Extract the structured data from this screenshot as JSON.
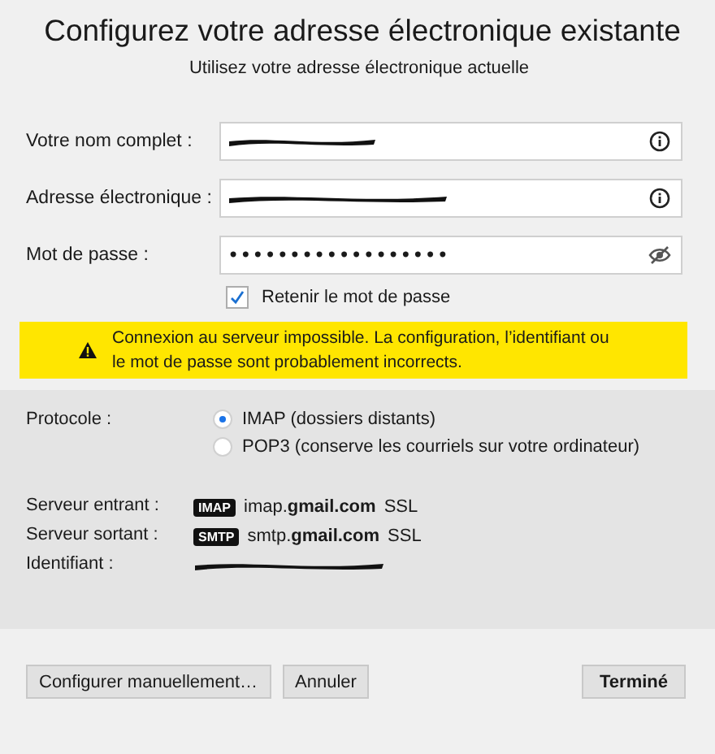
{
  "header": {
    "title": "Configurez votre adresse électronique existante",
    "subtitle": "Utilisez votre adresse électronique actuelle"
  },
  "fields": [
    {
      "kind": "text",
      "label": "Votre nom complet :",
      "redacted": true
    },
    {
      "kind": "text",
      "label": "Adresse électronique :",
      "redacted": true
    },
    {
      "kind": "password",
      "label": "Mot de passe :",
      "value": "••••••••••••••••••"
    }
  ],
  "remember": {
    "label": "Retenir le mot de passe",
    "checked": true
  },
  "warning": {
    "text": "Connexion au serveur impossible. La configuration, l’identifiant ou\nle mot de passe sont probablement incorrects."
  },
  "protocol": {
    "label": "Protocole :",
    "options": [
      {
        "label": "IMAP (dossiers distants)",
        "selected": true
      },
      {
        "label": "POP3 (conserve les courriels sur votre ordinateur)",
        "selected": false
      }
    ]
  },
  "servers": [
    {
      "label": "Serveur entrant :",
      "badge": "IMAP",
      "host": "imap.**gmail.com**",
      "security": "SSL"
    },
    {
      "label": "Serveur sortant :",
      "badge": "SMTP",
      "host": "smtp.**gmail.com**",
      "security": "SSL"
    }
  ],
  "identifier": {
    "label": "Identifiant :",
    "redacted": true
  },
  "buttons": [
    {
      "label": "Configurer manuellement…",
      "default": false
    },
    {
      "label": "Annuler",
      "default": false
    },
    {
      "label": "Terminé",
      "default": true
    }
  ]
}
